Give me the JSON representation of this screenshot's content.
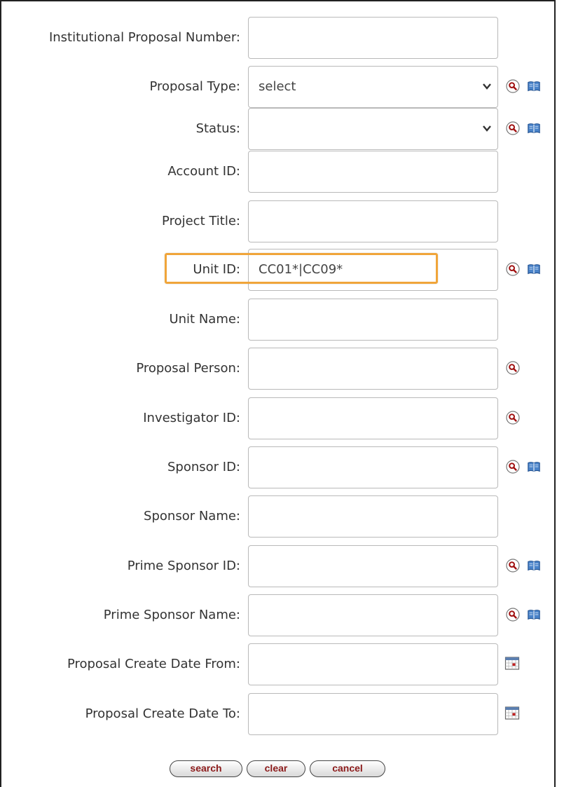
{
  "form": {
    "fields": [
      {
        "label": "Institutional Proposal Number:",
        "value": "",
        "type": "text"
      },
      {
        "label": "Proposal Type:",
        "value": "select",
        "type": "select"
      },
      {
        "label": "Status:",
        "value": "",
        "type": "select"
      },
      {
        "label": "Account ID:",
        "value": "",
        "type": "text"
      },
      {
        "label": "Project Title:",
        "value": "",
        "type": "text"
      },
      {
        "label": "Unit ID:",
        "value": "CC01*|CC09*",
        "type": "text"
      },
      {
        "label": "Unit Name:",
        "value": "",
        "type": "text"
      },
      {
        "label": "Proposal Person:",
        "value": "",
        "type": "text"
      },
      {
        "label": "Investigator ID:",
        "value": "",
        "type": "text"
      },
      {
        "label": "Sponsor ID:",
        "value": "",
        "type": "text"
      },
      {
        "label": "Sponsor Name:",
        "value": "",
        "type": "text"
      },
      {
        "label": "Prime Sponsor ID:",
        "value": "",
        "type": "text"
      },
      {
        "label": "Prime Sponsor Name:",
        "value": "",
        "type": "text"
      },
      {
        "label": "Proposal Create Date From:",
        "value": "",
        "type": "date"
      },
      {
        "label": "Proposal Create Date To:",
        "value": "",
        "type": "date"
      }
    ]
  },
  "buttons": {
    "search": "search",
    "clear": "clear",
    "cancel": "cancel"
  },
  "icons": {
    "lookup": "magnifier-lookup-icon",
    "help": "book-help-icon",
    "calendar": "calendar-icon"
  },
  "colors": {
    "highlight": "#f0a53a",
    "button_text": "#8b1a1a"
  }
}
